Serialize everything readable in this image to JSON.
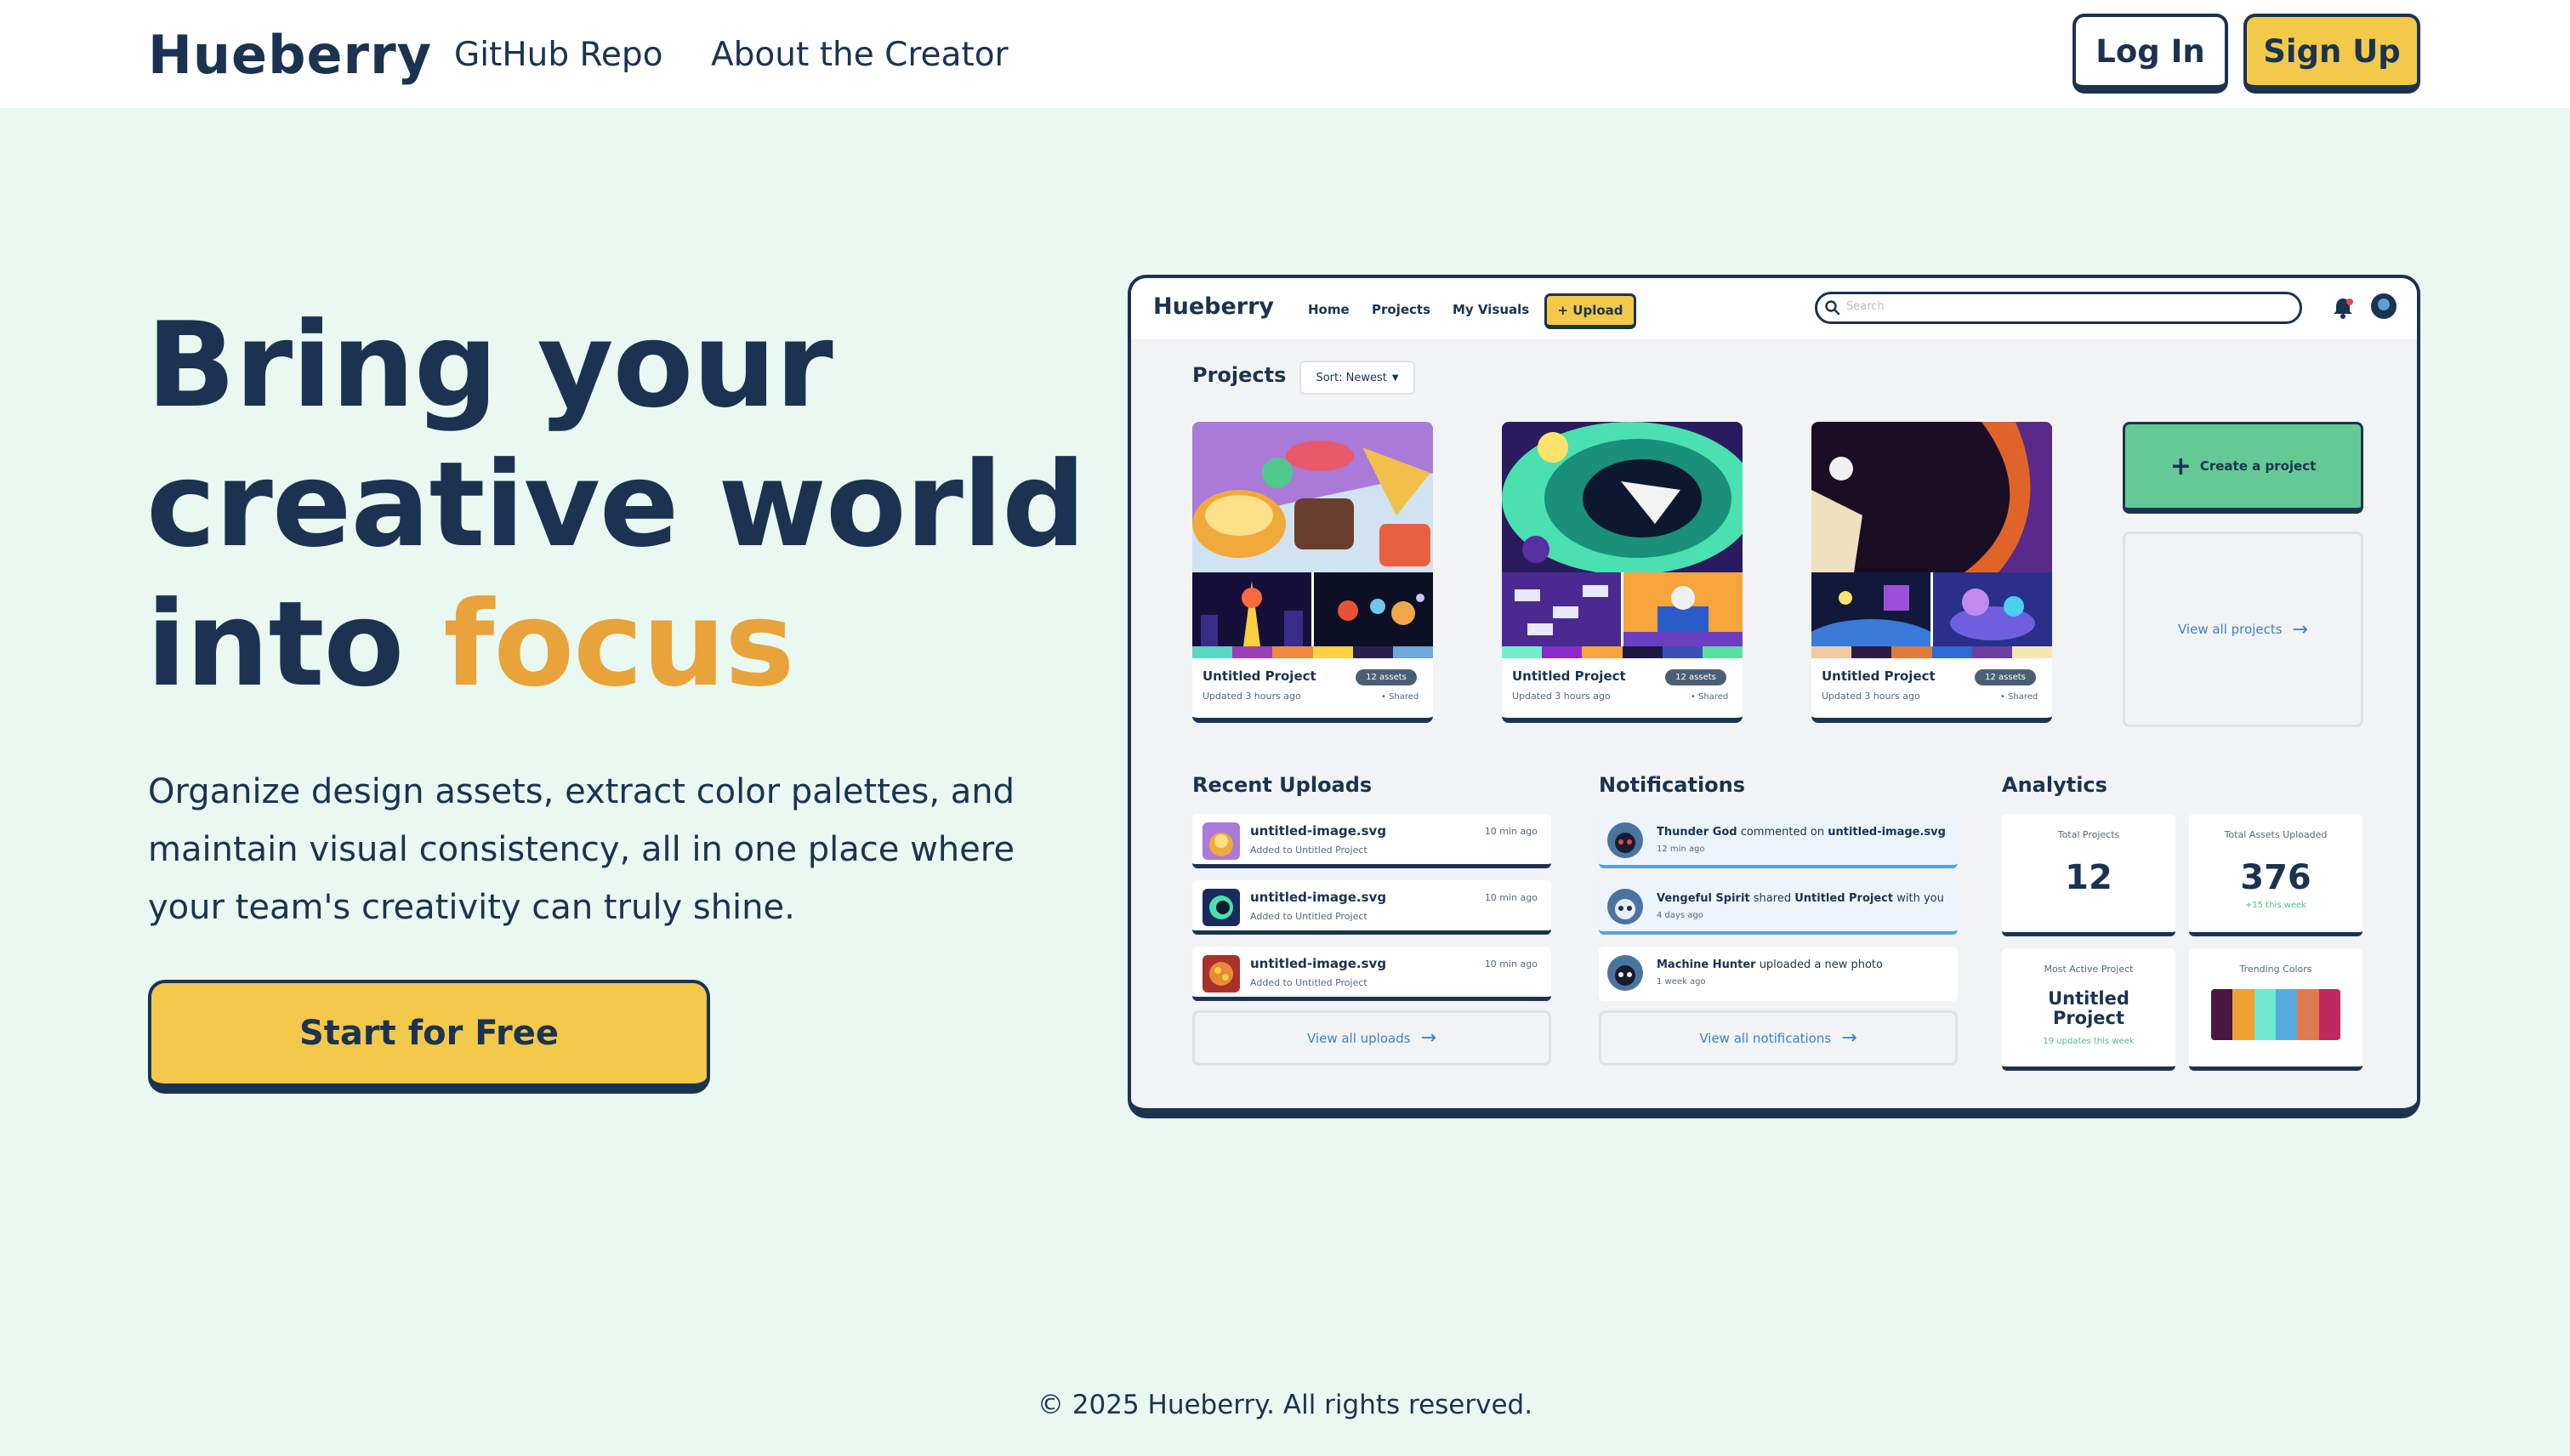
{
  "nav": {
    "logo": "Hueberry",
    "links": [
      "GitHub Repo",
      "About the Creator"
    ],
    "login": "Log In",
    "signup": "Sign Up"
  },
  "hero": {
    "line1": "Bring your",
    "line2": "creative world",
    "line3_prefix": "into ",
    "line3_accent": "focus",
    "subtitle": "Organize design assets, extract color palettes, and maintain visual consistency, all in one place where your team's creativity can truly shine.",
    "cta": "Start for Free"
  },
  "mockup": {
    "logo": "Hueberry",
    "nav": [
      "Home",
      "Projects",
      "My Visuals"
    ],
    "upload": "+ Upload",
    "search_placeholder": "Search",
    "projects_heading": "Projects",
    "sort_label": "Sort: Newest",
    "projects": [
      {
        "title": "Untitled Project",
        "badge": "12 assets",
        "updated": "Updated 3 hours ago",
        "shared": "• Shared",
        "palette": [
          "#5ad6c4",
          "#9b3fb8",
          "#f08a3c",
          "#ffd23f",
          "#2a1f4a",
          "#6fa8dc"
        ]
      },
      {
        "title": "Untitled Project",
        "badge": "12 assets",
        "updated": "Updated 3 hours ago",
        "shared": "• Shared",
        "palette": [
          "#6ff0c8",
          "#8a2bd0",
          "#f6a43b",
          "#1d1840",
          "#3a4fb8",
          "#58e0a0"
        ]
      },
      {
        "title": "Untitled Project",
        "badge": "12 assets",
        "updated": "Updated 3 hours ago",
        "shared": "• Shared",
        "palette": [
          "#f2c9a0",
          "#2d1b46",
          "#e07b39",
          "#2b6cd8",
          "#6b3fa0",
          "#f6e7b0"
        ]
      }
    ],
    "create_project": "Create a project",
    "view_all_projects": "View all projects",
    "recent_uploads_heading": "Recent Uploads",
    "uploads": [
      {
        "name": "untitled-image.svg",
        "sub": "Added to Untitled Project",
        "time": "10 min ago"
      },
      {
        "name": "untitled-image.svg",
        "sub": "Added to Untitled Project",
        "time": "10 min ago"
      },
      {
        "name": "untitled-image.svg",
        "sub": "Added to Untitled Project",
        "time": "10 min ago"
      }
    ],
    "view_all_uploads": "View all uploads",
    "notifications_heading": "Notifications",
    "notifications": [
      {
        "actor": "Thunder God",
        "action": " commented on ",
        "target": "untitled-image.svg",
        "tail": "",
        "time": "12 min ago"
      },
      {
        "actor": "Vengeful Spirit",
        "action": " shared ",
        "target": "Untitled Project",
        "tail": " with you",
        "time": "4 days ago"
      },
      {
        "actor": "Machine Hunter",
        "action": " uploaded a new photo",
        "target": "",
        "tail": "",
        "time": "1 week ago"
      }
    ],
    "view_all_notifications": "View all notifications",
    "analytics_heading": "Analytics",
    "analytics": {
      "total_projects_label": "Total Projects",
      "total_projects": "12",
      "total_assets_label": "Total Assets Uploaded",
      "total_assets": "376",
      "total_assets_sub": "+15 this week",
      "most_active_label": "Most Active Project",
      "most_active_l1": "Untitled",
      "most_active_l2": "Project",
      "most_active_sub": "19 updates this week",
      "trending_label": "Trending Colors",
      "trending_colors": [
        "#4a1742",
        "#f0a030",
        "#6ee8d0",
        "#5aa8e0",
        "#e07850",
        "#c02860"
      ]
    }
  },
  "footer": "© 2025 Hueberry. All rights reserved."
}
